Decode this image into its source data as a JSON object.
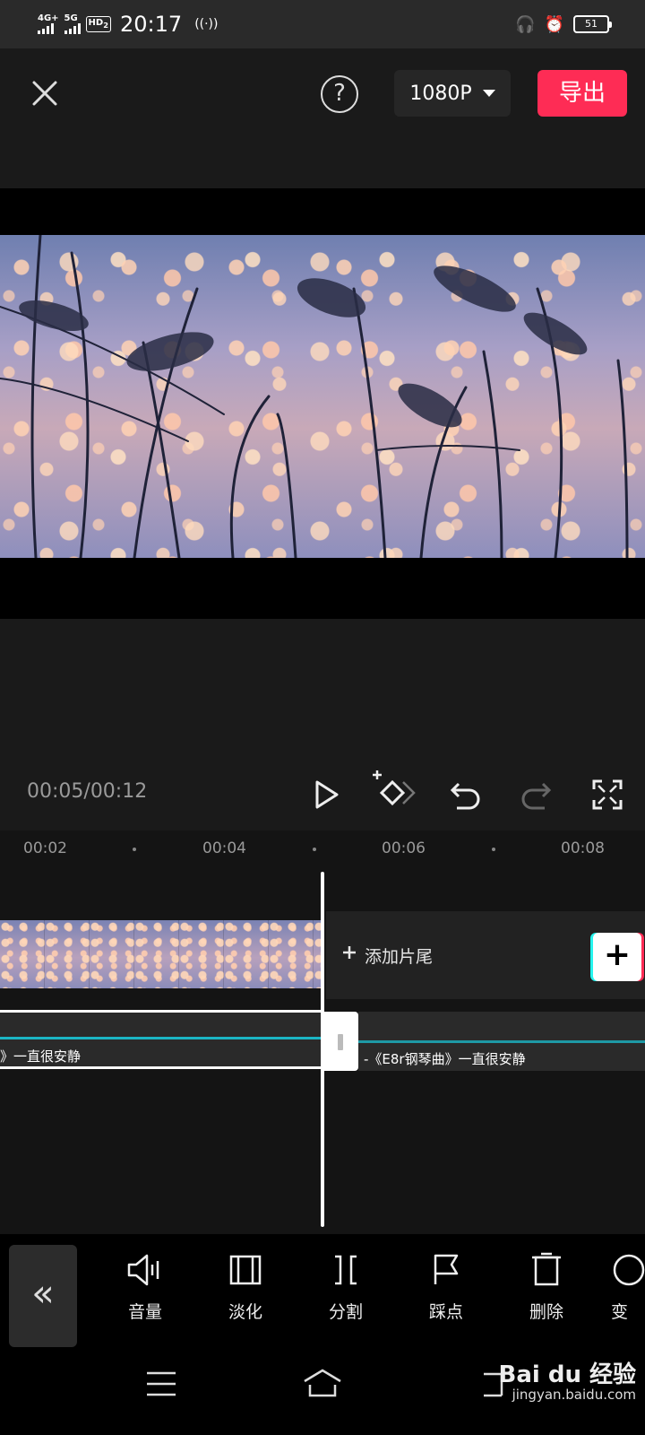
{
  "status_bar": {
    "network1": "4G+",
    "network2": "5G",
    "hd_label": "HD",
    "hd_sub": "2",
    "time": "20:17",
    "battery": "51"
  },
  "header": {
    "resolution": "1080P",
    "export_label": "导出",
    "help_label": "?"
  },
  "player": {
    "timecode": "00:05/00:12"
  },
  "ruler": {
    "ticks": [
      "00:02",
      "00:04",
      "00:06",
      "00:08"
    ]
  },
  "timeline": {
    "add_ending_label": "添加片尾",
    "add_clip_symbol": "+",
    "audio_left_text": "》一直很安静",
    "audio_right_text": "-《E8r钢琴曲》一直很安静"
  },
  "toolbar": {
    "collapse_symbol": "«",
    "tools": [
      {
        "label": "音量",
        "icon": "volume-icon"
      },
      {
        "label": "淡化",
        "icon": "fade-icon"
      },
      {
        "label": "分割",
        "icon": "split-icon"
      },
      {
        "label": "踩点",
        "icon": "beat-flag-icon"
      },
      {
        "label": "删除",
        "icon": "delete-icon"
      },
      {
        "label": "变",
        "icon": "speed-icon"
      }
    ]
  },
  "watermark": {
    "logo": "Bai du 经验",
    "url": "jingyan.baidu.com"
  }
}
